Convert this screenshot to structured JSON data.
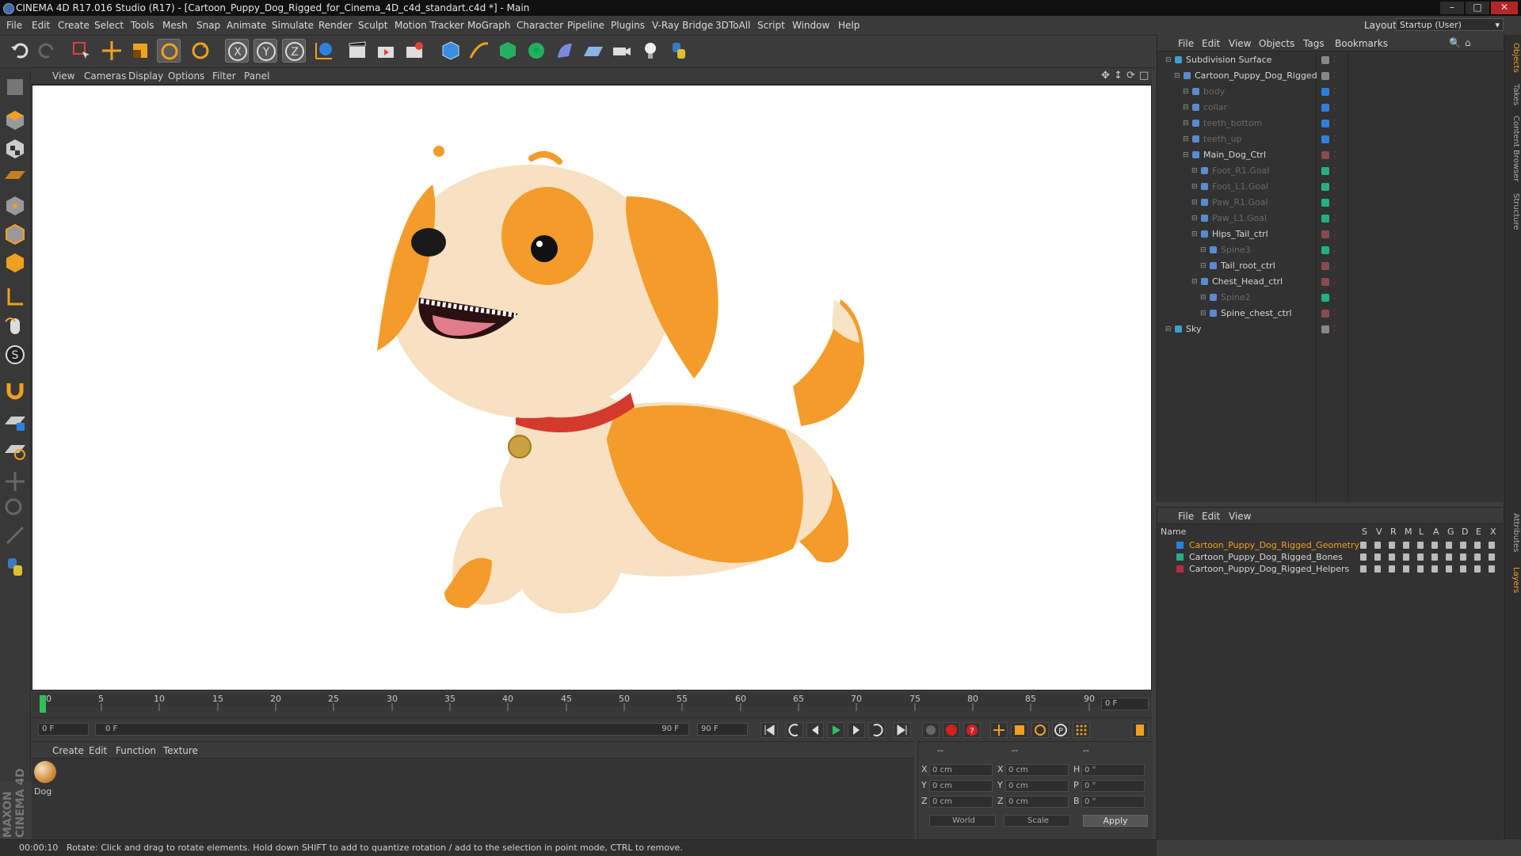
{
  "window": {
    "title": "CINEMA 4D R17.016 Studio (R17) - [Cartoon_Puppy_Dog_Rigged_for_Cinema_4D_c4d_standart.c4d *] - Main",
    "min": "–",
    "max": "□",
    "close": "✕"
  },
  "menubar": {
    "items": [
      "File",
      "Edit",
      "Create",
      "Select",
      "Tools",
      "Mesh",
      "Snap",
      "Animate",
      "Simulate",
      "Render",
      "Sculpt",
      "Motion Tracker",
      "MoGraph",
      "Character",
      "Pipeline",
      "Plugins",
      "V-Ray Bridge",
      "3DToAll",
      "Script",
      "Window",
      "Help"
    ],
    "layout_label": "Layout:",
    "layout_value": "Startup (User)"
  },
  "viewport": {
    "menu": [
      "View",
      "Cameras",
      "Display",
      "Options",
      "Filter",
      "Panel"
    ]
  },
  "timeline": {
    "ticks": [
      "0",
      "5",
      "10",
      "15",
      "20",
      "25",
      "30",
      "35",
      "40",
      "45",
      "50",
      "55",
      "60",
      "65",
      "70",
      "75",
      "80",
      "85",
      "90"
    ],
    "current_frame": "0 F",
    "start_field": "0 F",
    "range_start": "0 F",
    "range_end": "90 F",
    "end_field": "90 F"
  },
  "material_manager": {
    "menu": [
      "Create",
      "Edit",
      "Function",
      "Texture"
    ],
    "materials": [
      {
        "name": "Dog"
      }
    ]
  },
  "coordinates": {
    "col_headers": [
      "--",
      "--",
      "--"
    ],
    "rows": [
      {
        "a": "X",
        "av": "0 cm",
        "b": "X",
        "bv": "0 cm",
        "c": "H",
        "cv": "0 °"
      },
      {
        "a": "Y",
        "av": "0 cm",
        "b": "Y",
        "bv": "0 cm",
        "c": "P",
        "cv": "0 °"
      },
      {
        "a": "Z",
        "av": "0 cm",
        "b": "Z",
        "bv": "0 cm",
        "c": "B",
        "cv": "0 °"
      }
    ],
    "world": "World",
    "scale": "Scale",
    "apply": "Apply"
  },
  "status": {
    "time": "00:00:10",
    "message": "Rotate: Click and drag to rotate elements. Hold down SHIFT to add to quantize rotation / add to the selection in point mode, CTRL to remove."
  },
  "object_manager": {
    "menu": [
      "File",
      "Edit",
      "View",
      "Objects",
      "Tags",
      "Bookmarks"
    ],
    "rows": [
      {
        "name": "Subdivision Surface",
        "indent": 0,
        "dim": false,
        "color": "#888888"
      },
      {
        "name": "Cartoon_Puppy_Dog_Rigged",
        "indent": 1,
        "dim": false,
        "color": "#888888"
      },
      {
        "name": "body",
        "indent": 2,
        "dim": true,
        "color": "#2f7fe0"
      },
      {
        "name": "collar",
        "indent": 2,
        "dim": true,
        "color": "#2f7fe0"
      },
      {
        "name": "teeth_bottom",
        "indent": 2,
        "dim": true,
        "color": "#2f7fe0"
      },
      {
        "name": "teeth_up",
        "indent": 2,
        "dim": true,
        "color": "#2f7fe0"
      },
      {
        "name": "Main_Dog_Ctrl",
        "indent": 2,
        "dim": false,
        "color": "#8a4a52"
      },
      {
        "name": "Foot_R1.Goal",
        "indent": 3,
        "dim": true,
        "color": "#25b080"
      },
      {
        "name": "Foot_L1.Goal",
        "indent": 3,
        "dim": true,
        "color": "#25b080"
      },
      {
        "name": "Paw_R1.Goal",
        "indent": 3,
        "dim": true,
        "color": "#25b080"
      },
      {
        "name": "Paw_L1.Goal",
        "indent": 3,
        "dim": true,
        "color": "#25b080"
      },
      {
        "name": "Hips_Tail_ctrl",
        "indent": 3,
        "dim": false,
        "color": "#8a4a52"
      },
      {
        "name": "Spine3",
        "indent": 4,
        "dim": true,
        "color": "#25b080"
      },
      {
        "name": "Tail_root_ctrl",
        "indent": 4,
        "dim": false,
        "color": "#8a4a52"
      },
      {
        "name": "Chest_Head_ctrl",
        "indent": 3,
        "dim": false,
        "color": "#8a4a52"
      },
      {
        "name": "Spine2",
        "indent": 4,
        "dim": true,
        "color": "#25b080"
      },
      {
        "name": "Spine_chest_ctrl",
        "indent": 4,
        "dim": false,
        "color": "#8a4a52"
      },
      {
        "name": "Sky",
        "indent": 0,
        "dim": false,
        "color": "#888888"
      }
    ]
  },
  "layer_manager": {
    "menu": [
      "File",
      "Edit",
      "View"
    ],
    "name_col": "Name",
    "flag_cols": [
      "S",
      "V",
      "R",
      "M",
      "L",
      "A",
      "G",
      "D",
      "E",
      "X"
    ],
    "layers": [
      {
        "name": "Cartoon_Puppy_Dog_Rigged_Geometry",
        "color": "#2f7fe0",
        "active": true
      },
      {
        "name": "Cartoon_Puppy_Dog_Rigged_Bones",
        "color": "#25b080",
        "active": false
      },
      {
        "name": "Cartoon_Puppy_Dog_Rigged_Helpers",
        "color": "#b03040",
        "active": false
      }
    ]
  },
  "right_tabs": [
    "Objects",
    "Takes",
    "Content Browser",
    "Structure",
    "Attributes",
    "Layers"
  ],
  "brand": "MAXON CINEMA 4D"
}
